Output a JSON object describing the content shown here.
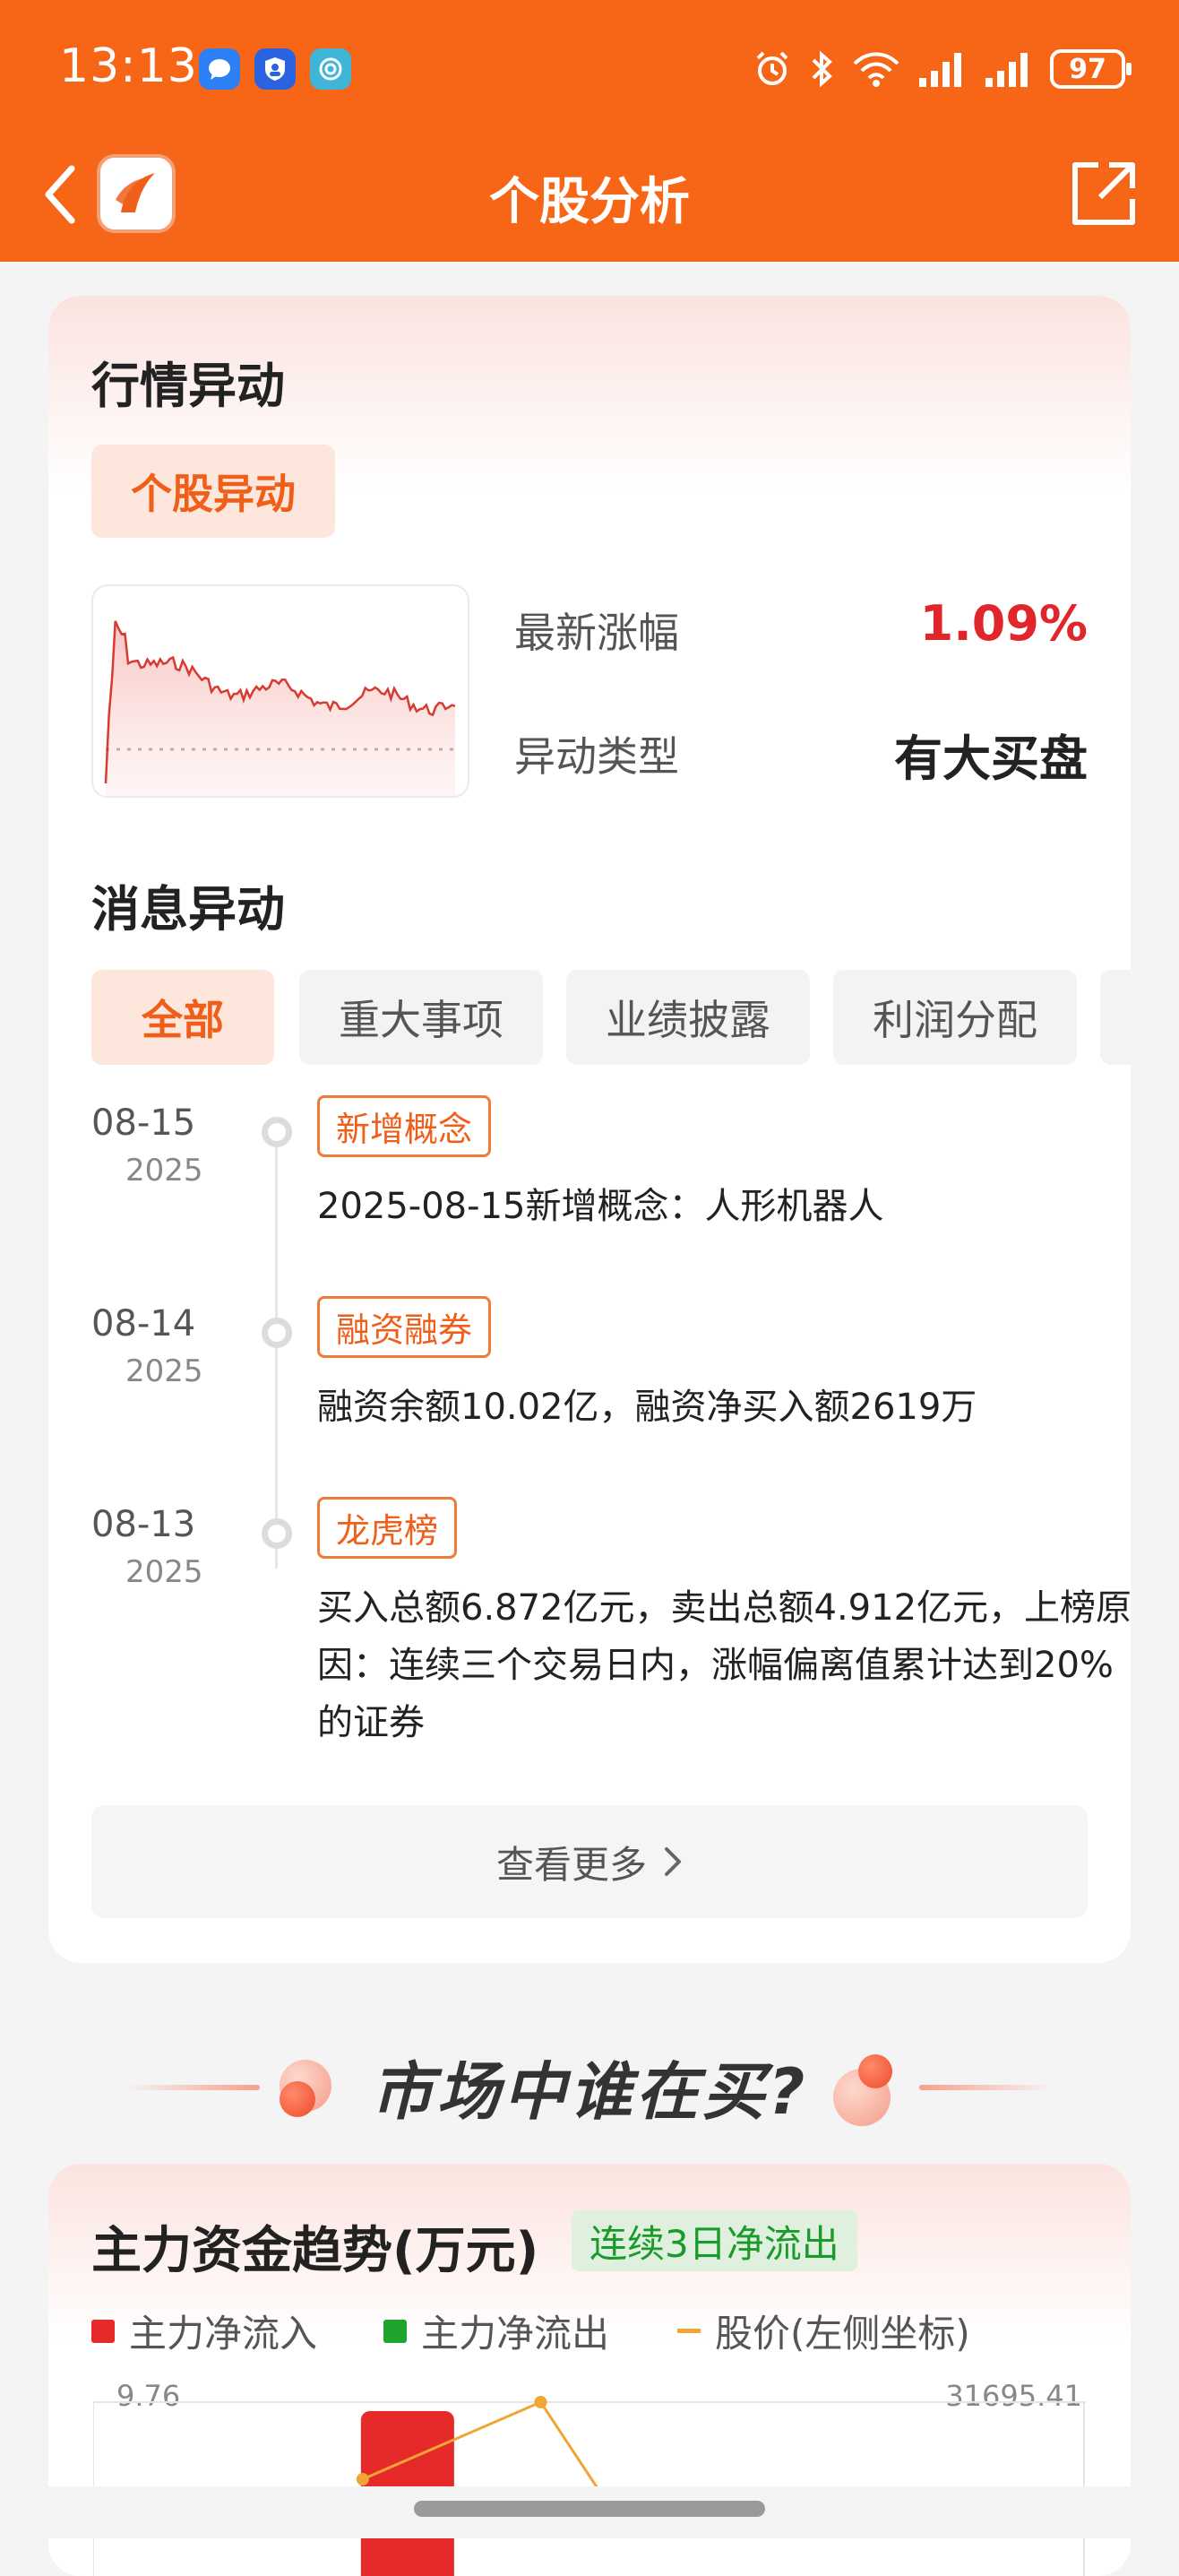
{
  "status_bar": {
    "time": "13:13",
    "battery": "97",
    "icons": [
      "message-icon",
      "shield-app-icon",
      "browser-app-icon",
      "alarm-icon",
      "bluetooth-icon",
      "wifi-icon",
      "signal-icon",
      "signal-icon"
    ]
  },
  "header": {
    "title": "个股分析"
  },
  "market_anomaly": {
    "title": "行情异动",
    "tag": "个股异动",
    "latest_change_label": "最新涨幅",
    "latest_change_value": "1.09%",
    "anomaly_type_label": "异动类型",
    "anomaly_type_value": "有大买盘",
    "colors": {
      "up": "#e0262b",
      "accent": "#f05f1a"
    }
  },
  "news_anomaly": {
    "title": "消息异动",
    "tabs": [
      {
        "label": "全部",
        "active": true
      },
      {
        "label": "重大事项",
        "active": false
      },
      {
        "label": "业绩披露",
        "active": false
      },
      {
        "label": "利润分配",
        "active": false
      }
    ],
    "items": [
      {
        "date": "08-15",
        "year": "2025",
        "tag": "新增概念",
        "text": "2025-08-15新增概念：人形机器人"
      },
      {
        "date": "08-14",
        "year": "2025",
        "tag": "融资融券",
        "text": "融资余额10.02亿，融资净买入额2619万"
      },
      {
        "date": "08-13",
        "year": "2025",
        "tag": "龙虎榜",
        "text": "买入总额6.872亿元，卖出总额4.912亿元，上榜原因：连续三个交易日内，涨幅偏离值累计达到20%的证券"
      }
    ],
    "more_label": "查看更多"
  },
  "promo": {
    "title": "市场中谁在买?"
  },
  "capital_trend": {
    "title": "主力资金趋势(万元)",
    "badge": "连续3日净流出",
    "legend": [
      {
        "label": "主力净流入",
        "color": "#e62a2a"
      },
      {
        "label": "主力净流出",
        "color": "#1fa52e"
      },
      {
        "label": "股价(左侧坐标)",
        "color": "#f0a535"
      }
    ],
    "axis_left_max": "9.76",
    "axis_right_max": "31695.41"
  },
  "chart_data": {
    "type": "bar",
    "title": "主力资金趋势(万元)",
    "series": [
      {
        "name": "主力净流入",
        "values": [
          null,
          31695.41,
          null
        ]
      },
      {
        "name": "股价(左侧坐标)",
        "values": [
          null,
          null,
          9.76
        ]
      }
    ],
    "ylim_left": [
      null,
      9.76
    ],
    "ylim_right": [
      null,
      31695.41
    ],
    "legend": "top-left",
    "grid": true
  }
}
